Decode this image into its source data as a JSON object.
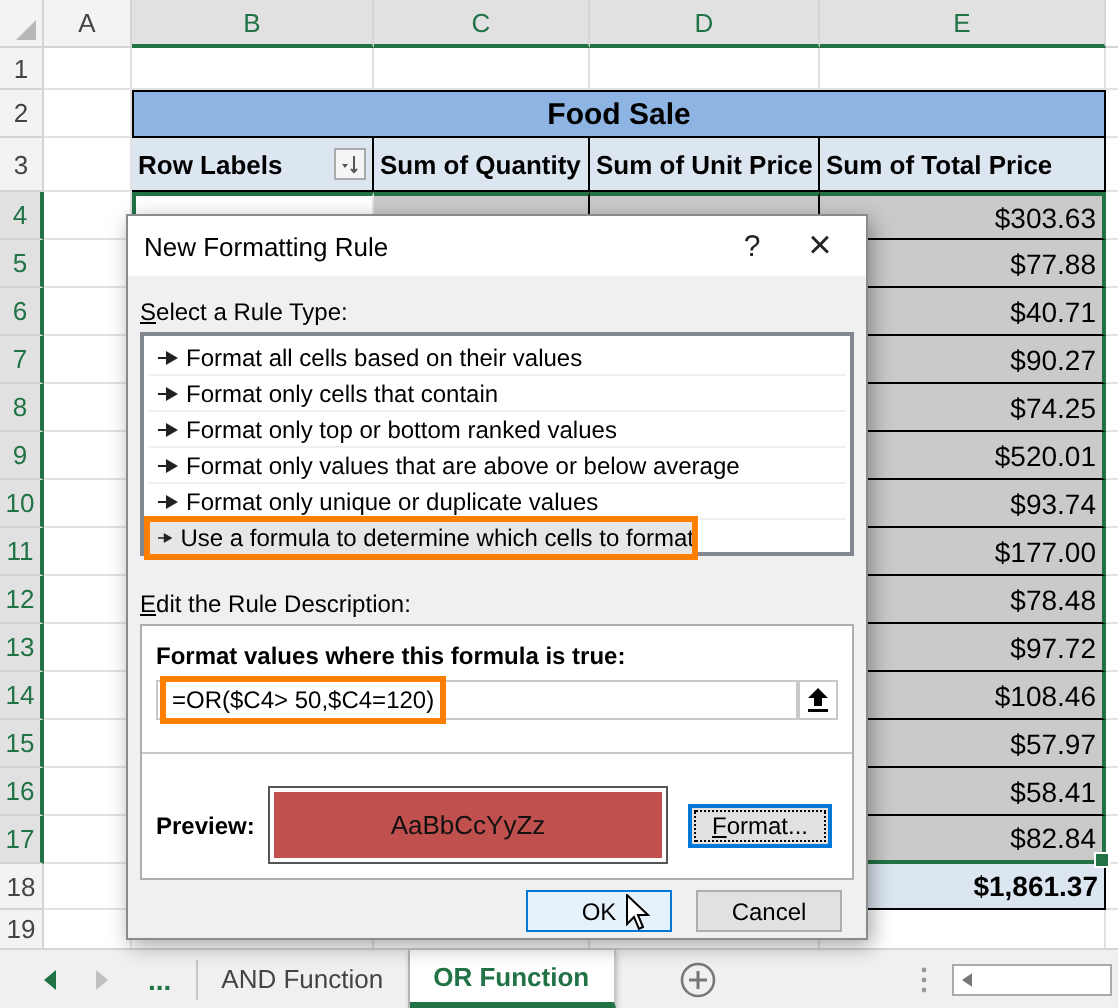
{
  "column_headers": [
    {
      "label": "A",
      "selected": false
    },
    {
      "label": "B",
      "selected": true
    },
    {
      "label": "C",
      "selected": true
    },
    {
      "label": "D",
      "selected": true
    },
    {
      "label": "E",
      "selected": true
    }
  ],
  "row_headers": [
    {
      "label": "1",
      "selected": false
    },
    {
      "label": "2",
      "selected": false
    },
    {
      "label": "3",
      "selected": false
    },
    {
      "label": "4",
      "selected": true
    },
    {
      "label": "5",
      "selected": true
    },
    {
      "label": "6",
      "selected": true
    },
    {
      "label": "7",
      "selected": true
    },
    {
      "label": "8",
      "selected": true
    },
    {
      "label": "9",
      "selected": true
    },
    {
      "label": "10",
      "selected": true
    },
    {
      "label": "11",
      "selected": true
    },
    {
      "label": "12",
      "selected": true
    },
    {
      "label": "13",
      "selected": true
    },
    {
      "label": "14",
      "selected": true
    },
    {
      "label": "15",
      "selected": true
    },
    {
      "label": "16",
      "selected": true
    },
    {
      "label": "17",
      "selected": true
    },
    {
      "label": "18",
      "selected": false
    },
    {
      "label": "19",
      "selected": false
    }
  ],
  "pivot": {
    "title": "Food Sale",
    "columns": [
      "Row Labels",
      "Sum of Quantity",
      "Sum of Unit Price",
      "Sum of Total Price"
    ],
    "rows": [
      {
        "total_price": "$303.63"
      },
      {
        "total_price": "$77.88"
      },
      {
        "total_price": "$40.71"
      },
      {
        "total_price": "$90.27"
      },
      {
        "total_price": "$74.25"
      },
      {
        "total_price": "$520.01"
      },
      {
        "total_price": "$93.74"
      },
      {
        "total_price": "$177.00"
      },
      {
        "total_price": "$78.48"
      },
      {
        "total_price": "$97.72"
      },
      {
        "total_price": "$108.46"
      },
      {
        "total_price": "$57.97"
      },
      {
        "total_price": "$58.41"
      },
      {
        "total_price": "$82.84"
      }
    ],
    "grand_total": "$1,861.37"
  },
  "dialog": {
    "title": "New Formatting Rule",
    "help": "?",
    "close": "×",
    "rule_type_label": "Select a Rule Type:",
    "rule_types": [
      {
        "label": "Format all cells based on their values",
        "selected": false,
        "highlighted": false
      },
      {
        "label": "Format only cells that contain",
        "selected": false,
        "highlighted": false
      },
      {
        "label": "Format only top or bottom ranked values",
        "selected": false,
        "highlighted": false
      },
      {
        "label": "Format only values that are above or below average",
        "selected": false,
        "highlighted": false
      },
      {
        "label": "Format only unique or duplicate values",
        "selected": false,
        "highlighted": false
      },
      {
        "label": "Use a formula to determine which cells to format",
        "selected": true,
        "highlighted": true
      }
    ],
    "description_label": "Edit the Rule Description:",
    "formula_label": "Format values where this formula is true:",
    "formula": {
      "value": "=OR($C4> 50,$C4=120)",
      "highlighted": true
    },
    "preview_label": "Preview:",
    "preview_text": "AaBbCcYyZz",
    "format_button": "Format...",
    "buttons": [
      "OK",
      "Cancel"
    ]
  },
  "sheet_tabs": {
    "more": "...",
    "tabs": [
      {
        "label": "AND Function",
        "selected": false
      },
      {
        "label": "OR Function",
        "selected": true
      }
    ]
  }
}
